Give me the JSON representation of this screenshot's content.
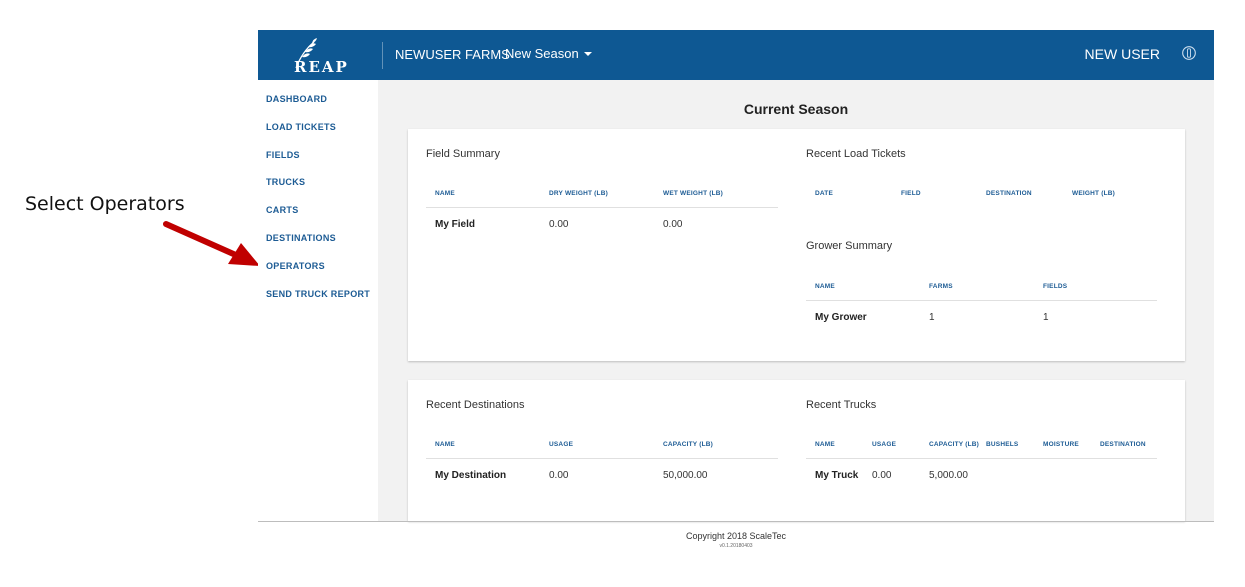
{
  "annotation": {
    "text": "Select Operators"
  },
  "header": {
    "logo_text": "REAP",
    "farm_name": "NEWUSER FARMS",
    "season": "New Season",
    "user": "NEW USER"
  },
  "sidebar": {
    "items": [
      {
        "label": "DASHBOARD"
      },
      {
        "label": "LOAD TICKETS"
      },
      {
        "label": "FIELDS"
      },
      {
        "label": "TRUCKS"
      },
      {
        "label": "CARTS"
      },
      {
        "label": "DESTINATIONS"
      },
      {
        "label": "OPERATORS"
      },
      {
        "label": "SEND TRUCK REPORT"
      }
    ]
  },
  "main": {
    "title": "Current Season",
    "field_summary": {
      "title": "Field Summary",
      "headers": [
        "NAME",
        "DRY WEIGHT (LB)",
        "WET WEIGHT (LB)"
      ],
      "rows": [
        [
          "My Field",
          "0.00",
          "0.00"
        ]
      ]
    },
    "recent_load_tickets": {
      "title": "Recent Load Tickets",
      "headers": [
        "DATE",
        "FIELD",
        "DESTINATION",
        "WEIGHT (LB)"
      ]
    },
    "grower_summary": {
      "title": "Grower Summary",
      "headers": [
        "NAME",
        "FARMS",
        "FIELDS"
      ],
      "rows": [
        [
          "My Grower",
          "1",
          "1"
        ]
      ]
    },
    "recent_destinations": {
      "title": "Recent Destinations",
      "headers": [
        "NAME",
        "USAGE",
        "CAPACITY (LB)"
      ],
      "rows": [
        [
          "My Destination",
          "0.00",
          "50,000.00"
        ]
      ]
    },
    "recent_trucks": {
      "title": "Recent Trucks",
      "headers": [
        "NAME",
        "USAGE",
        "CAPACITY (LB)",
        "BUSHELS",
        "MOISTURE",
        "DESTINATION"
      ],
      "rows": [
        [
          "My Truck",
          "0.00",
          "5,000.00",
          "",
          "",
          ""
        ]
      ]
    }
  },
  "footer": {
    "copyright": "Copyright 2018 ScaleTec",
    "version": "v0.1.20180403"
  },
  "colors": {
    "header_bg": "#0e5893",
    "nav_text": "#1c5b94",
    "annotation_arrow": "#c00000",
    "main_bg": "#f2f2f2"
  }
}
